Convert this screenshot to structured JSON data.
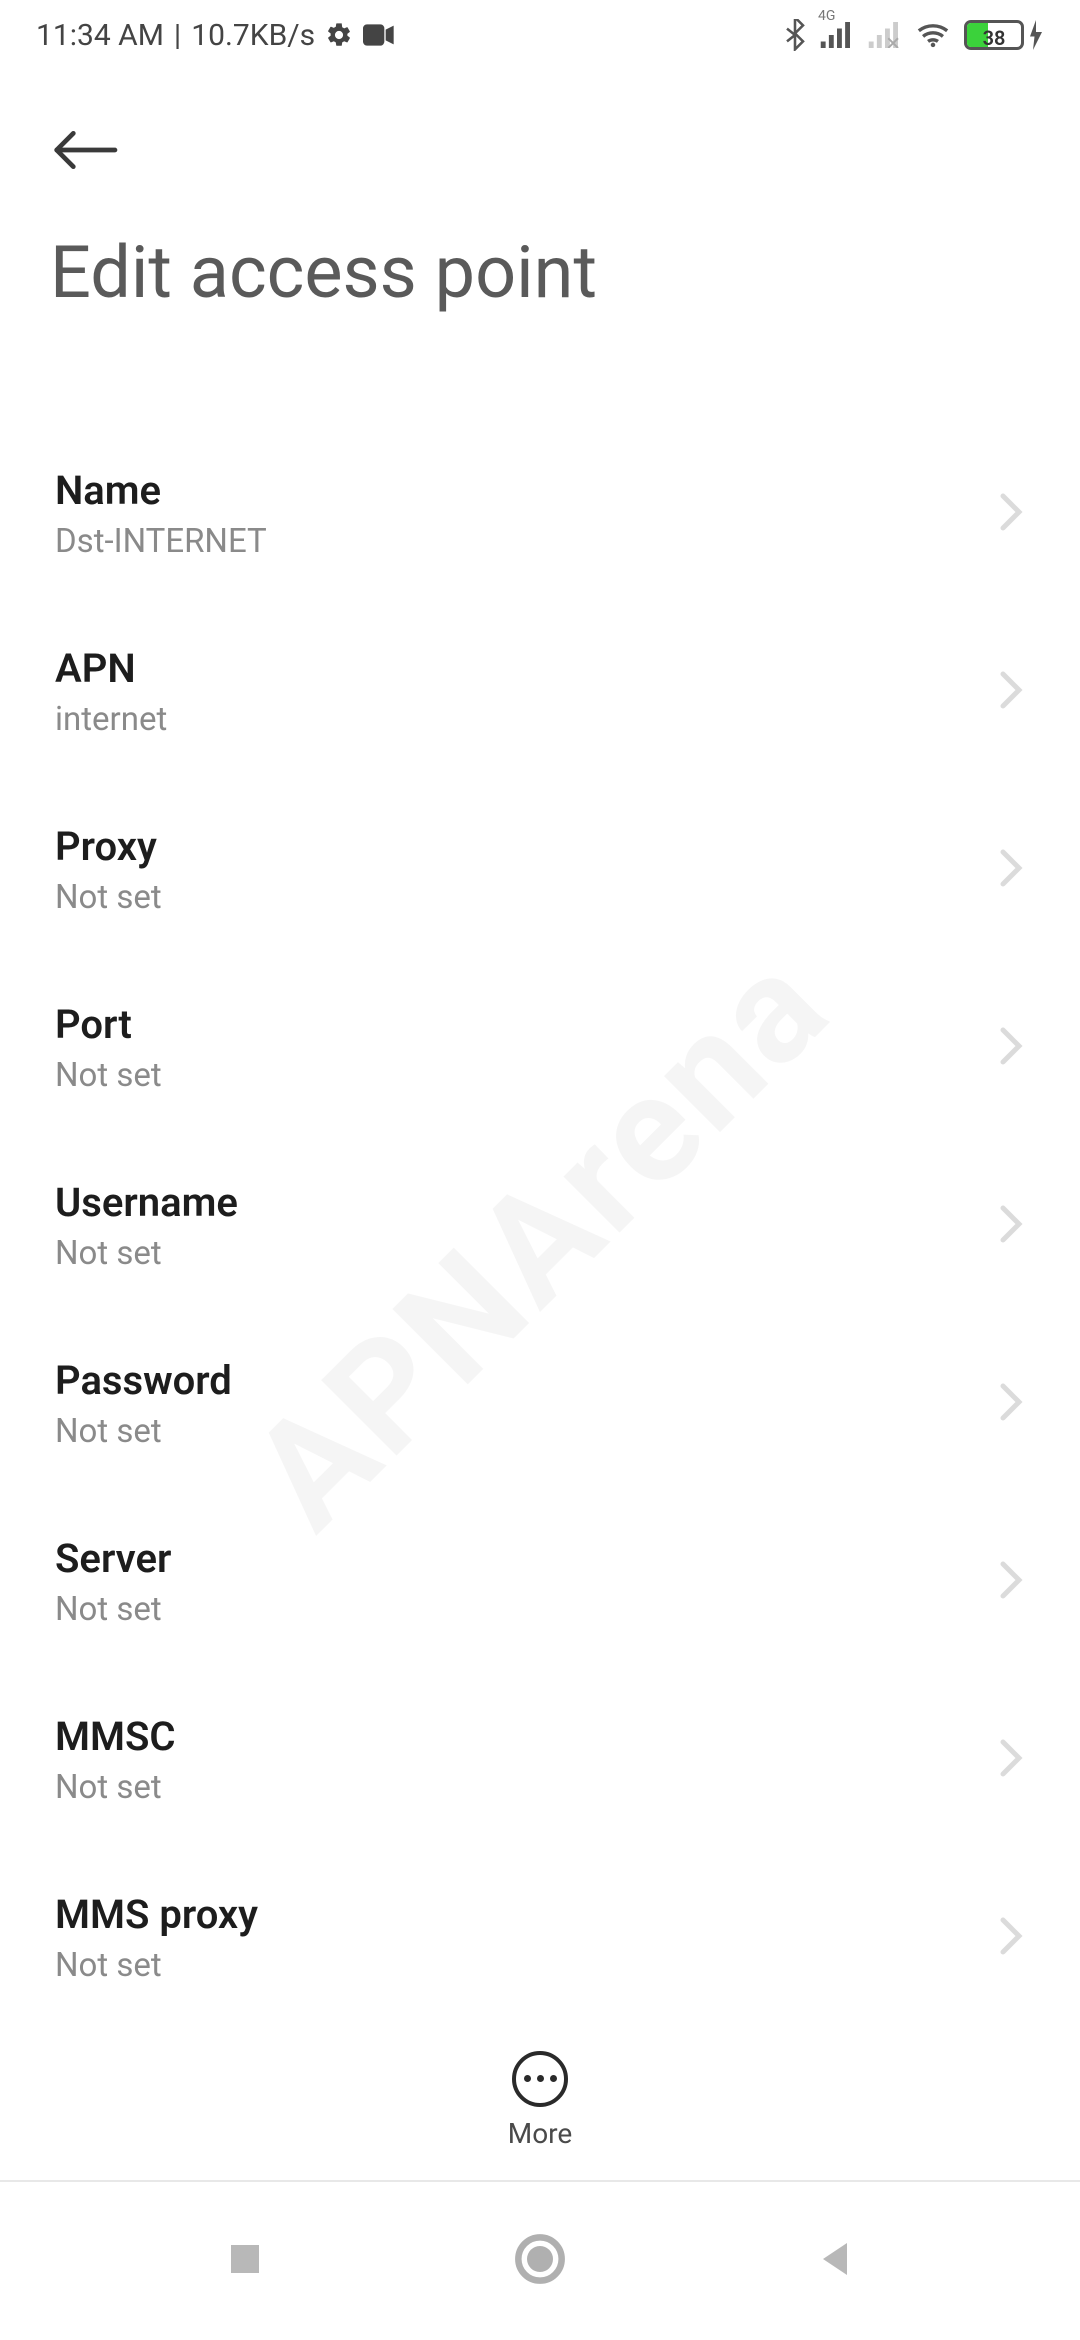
{
  "status_bar": {
    "time": "11:34 AM",
    "speed": "10.7KB/s",
    "network_label": "4G",
    "battery_pct": "38"
  },
  "header": {
    "title": "Edit access point"
  },
  "items": [
    {
      "label": "Name",
      "value": "Dst-INTERNET"
    },
    {
      "label": "APN",
      "value": "internet"
    },
    {
      "label": "Proxy",
      "value": "Not set"
    },
    {
      "label": "Port",
      "value": "Not set"
    },
    {
      "label": "Username",
      "value": "Not set"
    },
    {
      "label": "Password",
      "value": "Not set"
    },
    {
      "label": "Server",
      "value": "Not set"
    },
    {
      "label": "MMSC",
      "value": "Not set"
    },
    {
      "label": "MMS proxy",
      "value": "Not set"
    }
  ],
  "more": {
    "label": "More"
  },
  "watermark": "APNArena"
}
